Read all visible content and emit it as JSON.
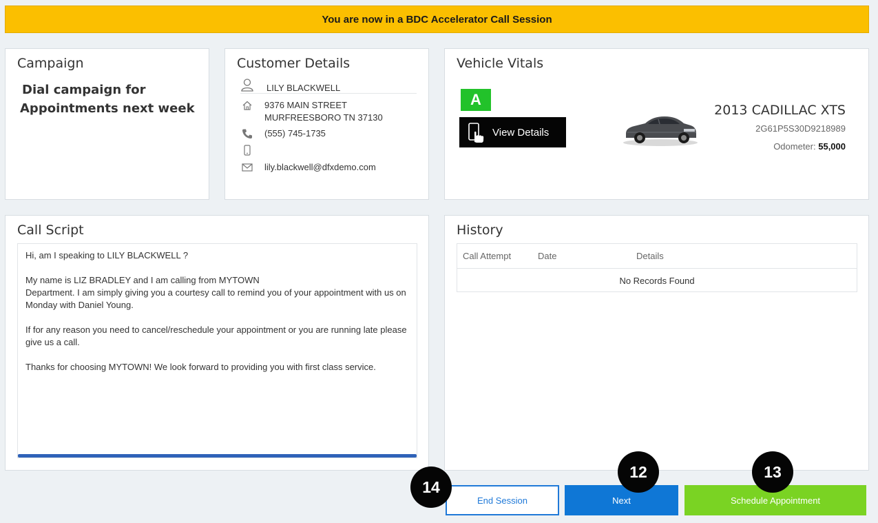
{
  "banner": {
    "text": "You are now in a BDC Accelerator Call Session",
    "color": "#fbbf00"
  },
  "campaign": {
    "title": "Campaign",
    "line1": "Dial campaign for",
    "line2": "Appointments next week"
  },
  "customer": {
    "title": "Customer Details",
    "name": "LILY BLACKWELL",
    "address_line1": "9376 MAIN STREET",
    "address_line2": "MURFREESBORO TN 37130",
    "phone": "(555) 745-1735",
    "mobile": "",
    "email": "lily.blackwell@dfxdemo.com",
    "icons": [
      "user-icon",
      "home-icon",
      "phone-icon",
      "mobile-icon",
      "email-icon"
    ]
  },
  "vehicle": {
    "title": "Vehicle Vitals",
    "grade": "A",
    "grade_color": "#22c22a",
    "view_details_label": "View Details",
    "name": "2013 CADILLAC XTS",
    "vin": "2G61P5S30D9218989",
    "odometer_label": "Odometer:",
    "odometer_value": "55,000"
  },
  "script": {
    "title": "Call Script",
    "p1_prefix": "Hi, am I speaking to ",
    "p1_name": "LILY BLACKWELL",
    "p1_suffix": " ?",
    "p2_line1": "My name is LIZ BRADLEY and I am calling from MYTOWN",
    "p2_line2": "Department.  I am simply giving you a courtesy call to remind you of your appointment with us on Monday with Daniel Young.",
    "p3": "If for any reason you need to cancel/reschedule your appointment or you are running late please give us a call.",
    "p4": "Thanks for choosing MYTOWN!  We look forward to providing you with first class service."
  },
  "history": {
    "title": "History",
    "columns": [
      "Call Attempt",
      "Date",
      "Details"
    ],
    "empty_message": "No Records Found"
  },
  "actions": {
    "end_session": "End Session",
    "next": "Next",
    "schedule": "Schedule Appointment",
    "end_badge": "14",
    "next_badge": "12",
    "schedule_badge": "13"
  }
}
